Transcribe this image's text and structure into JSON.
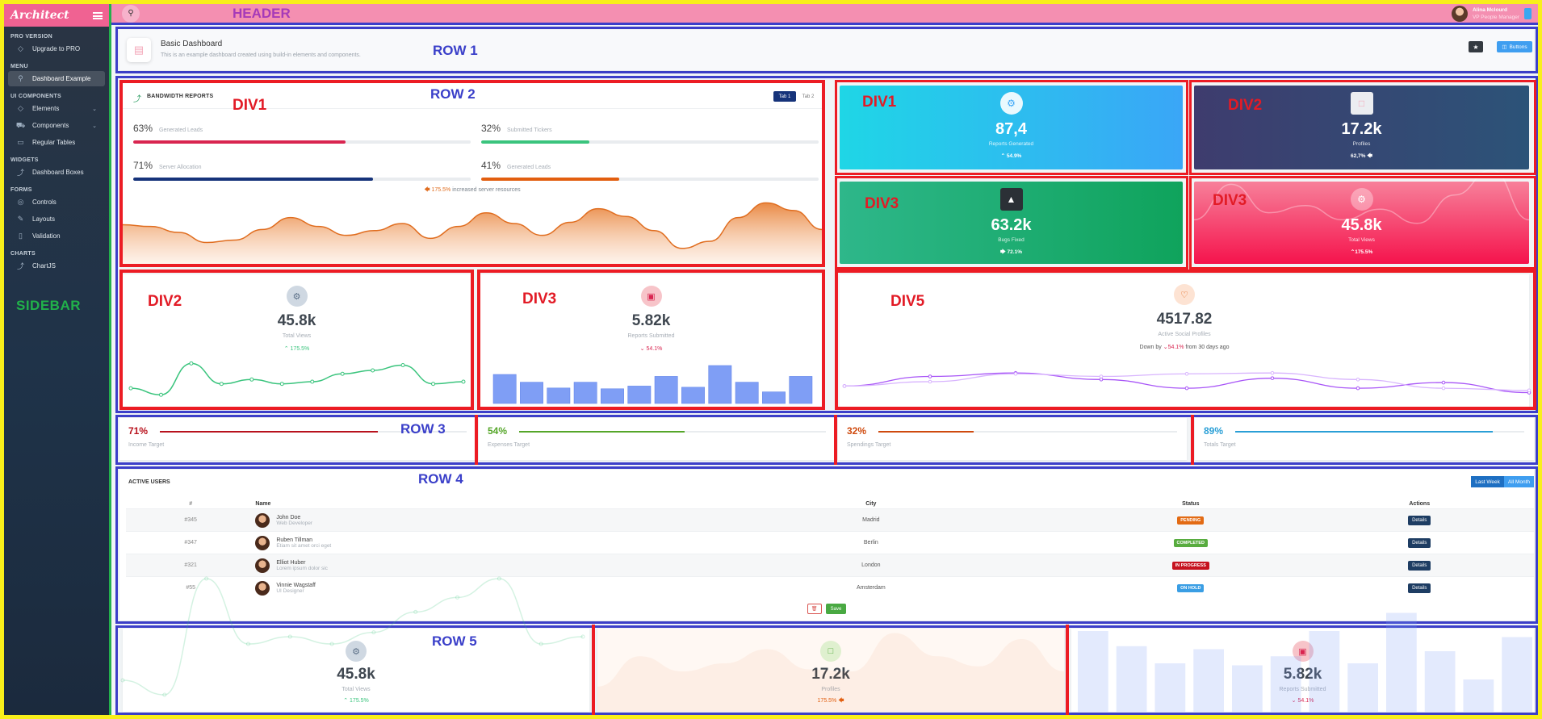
{
  "sidebar": {
    "logo": "Architect",
    "sections": [
      {
        "heading": "PRO VERSION",
        "items": [
          {
            "label": "Upgrade to PRO",
            "icon": "diamond-icon"
          }
        ]
      },
      {
        "heading": "MENU",
        "items": [
          {
            "label": "Dashboard Example",
            "icon": "rocket-icon",
            "active": true
          }
        ]
      },
      {
        "heading": "UI COMPONENTS",
        "items": [
          {
            "label": "Elements",
            "icon": "diamond-icon",
            "expand": true
          },
          {
            "label": "Components",
            "icon": "car-icon",
            "expand": true
          },
          {
            "label": "Regular Tables",
            "icon": "display-icon"
          }
        ]
      },
      {
        "heading": "WIDGETS",
        "items": [
          {
            "label": "Dashboard Boxes",
            "icon": "graph-icon"
          }
        ]
      },
      {
        "heading": "FORMS",
        "items": [
          {
            "label": "Controls",
            "icon": "light-icon"
          },
          {
            "label": "Layouts",
            "icon": "eyedropper-icon"
          },
          {
            "label": "Validation",
            "icon": "pendrive-icon"
          }
        ]
      },
      {
        "heading": "CHARTS",
        "items": [
          {
            "label": "ChartJS",
            "icon": "graph-icon"
          }
        ]
      }
    ],
    "overlay_label": "SIDEBAR"
  },
  "header": {
    "overlay_label": "HEADER",
    "user_name": "Alina Mclourd",
    "user_role": "VP People Manager"
  },
  "row1": {
    "overlay_label": "ROW 1",
    "title": "Basic Dashboard",
    "subtitle": "This is an example dashboard created using build-in elements and components.",
    "buttons_label": "Buttons",
    "star": "★"
  },
  "row2": {
    "overlay_label": "ROW 2"
  },
  "bandwidth": {
    "overlay_label": "DIV1",
    "title": "BANDWIDTH REPORTS",
    "tabs": [
      "Tab 1",
      "Tab 2"
    ],
    "bars": [
      {
        "pct": "63%",
        "label": "Generated Leads",
        "value": 63,
        "color": "#d92550"
      },
      {
        "pct": "32%",
        "label": "Submitted Tickers",
        "value": 32,
        "color": "#3ac47d"
      },
      {
        "pct": "71%",
        "label": "Server Allocation",
        "value": 71,
        "color": "#16337a"
      },
      {
        "pct": "41%",
        "label": "Generated Leads",
        "value": 41,
        "color": "#e25e0f"
      }
    ],
    "note_arrow": "🡄",
    "note_pct": "175.5%",
    "note_text": "increased server resources",
    "area": [
      0.58,
      0.55,
      0.45,
      0.28,
      0.32,
      0.5,
      0.7,
      0.55,
      0.4,
      0.48,
      0.6,
      0.35,
      0.55,
      0.78,
      0.6,
      0.4,
      0.62,
      0.85,
      0.72,
      0.48,
      0.18,
      0.3,
      0.7,
      0.95,
      0.82,
      0.5
    ]
  },
  "tiles": [
    {
      "overlay_label": "DIV1",
      "value": "87,4",
      "label": "Reports Generated",
      "change": "54.9%",
      "arrow": "⌃",
      "icon": "gear-icon"
    },
    {
      "overlay_label": "DIV2",
      "value": "17.2k",
      "label": "Profiles",
      "change": "62,7%",
      "arrow": "🡄",
      "icon": "monitor-icon"
    },
    {
      "overlay_label": "DIV3",
      "value": "63.2k",
      "label": "Bugs Fixed",
      "change": "72.1%",
      "arrow": "🡆",
      "icon": "graduation-cap-icon"
    },
    {
      "overlay_label": "DIV3",
      "value": "45.8k",
      "label": "Total Views",
      "change": "175.5%",
      "arrow": "⌃",
      "icon": "gear-icon"
    }
  ],
  "stat_views": {
    "overlay_label": "DIV2",
    "value": "45.8k",
    "label": "Total Views",
    "change": "175.5%",
    "arrow": "⌃",
    "line": [
      0.35,
      0.2,
      0.92,
      0.45,
      0.55,
      0.45,
      0.5,
      0.68,
      0.76,
      0.88,
      0.45,
      0.5
    ]
  },
  "stat_reports": {
    "overlay_label": "DIV3",
    "value": "5.82k",
    "label": "Reports Submitted",
    "change": "54.1%",
    "arrow": "⌄",
    "bars": [
      0.75,
      0.55,
      0.4,
      0.55,
      0.38,
      0.45,
      0.7,
      0.42,
      0.98,
      0.55,
      0.3,
      0.7
    ]
  },
  "stat_social": {
    "overlay_label": "DIV5",
    "value": "4517.82",
    "label": "Active Social Profiles",
    "change_prefix": "Down by",
    "change": "54.1%",
    "change_suffix": "from 30 days ago",
    "arrow": "⌄",
    "line_a": [
      0.4,
      0.62,
      0.7,
      0.55,
      0.35,
      0.58,
      0.35,
      0.48,
      0.25
    ],
    "line_b": [
      0.4,
      0.5,
      0.68,
      0.62,
      0.68,
      0.7,
      0.55,
      0.35,
      0.3
    ]
  },
  "row3": {
    "overlay_label": "ROW 3",
    "targets": [
      {
        "pct": "71%",
        "label": "Income Target",
        "value": 71,
        "color": "#b8121d"
      },
      {
        "pct": "54%",
        "label": "Expenses Target",
        "value": 54,
        "color": "#55a629"
      },
      {
        "pct": "32%",
        "label": "Spendings Target",
        "value": 32,
        "color": "#cf4a0e"
      },
      {
        "pct": "89%",
        "label": "Totals Target",
        "value": 89,
        "color": "#2a9fd6"
      }
    ]
  },
  "row4": {
    "overlay_label": "ROW 4",
    "title": "ACTIVE USERS",
    "range_buttons": [
      "Last Week",
      "All Month"
    ],
    "columns": [
      "#",
      "Name",
      "City",
      "Status",
      "Actions"
    ],
    "rows": [
      {
        "id": "#345",
        "name": "John Doe",
        "role": "Web Developer",
        "city": "Madrid",
        "status": "PENDING",
        "status_color": "#e36b14"
      },
      {
        "id": "#347",
        "name": "Ruben Tillman",
        "role": "Etiam sit amet orci eget",
        "city": "Berlin",
        "status": "COMPLETED",
        "status_color": "#58ac3f"
      },
      {
        "id": "#321",
        "name": "Elliot Huber",
        "role": "Lorem ipsum dolor sic",
        "city": "London",
        "status": "IN PROGRESS",
        "status_color": "#c6131f"
      },
      {
        "id": "#55",
        "name": "Vinnie Wagstaff",
        "role": "UI Designer",
        "city": "Amsterdam",
        "status": "ON HOLD",
        "status_color": "#3a9ee4"
      }
    ],
    "details_label": "Details",
    "delete_label": "🗑",
    "save_label": "Save"
  },
  "row5": {
    "overlay_label": "ROW 5",
    "cards": [
      {
        "value": "45.8k",
        "label": "Total Views",
        "change": "175.5%",
        "arrow": "⌃"
      },
      {
        "value": "17.2k",
        "label": "Profiles",
        "change": "175.5%",
        "arrow": "🡄"
      },
      {
        "value": "5.82k",
        "label": "Reports Submitted",
        "change": "54.1%",
        "arrow": "⌄"
      }
    ]
  }
}
